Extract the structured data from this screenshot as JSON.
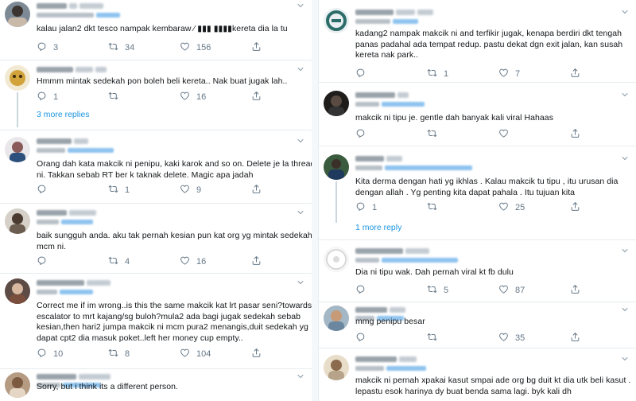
{
  "left": {
    "t1": {
      "lines": [
        "kalau jalan2 dkt tesco nampak kembaraw ⁄ ▮▮▮ ▮▮▮▮kereta dia la tu"
      ],
      "counts": {
        "reply": "3",
        "retweet": "34",
        "like": "156"
      }
    },
    "t2": {
      "lines": [
        "Hmmm mintak sedekah pon boleh beli kereta.. Nak buat jugak lah.."
      ],
      "counts": {
        "reply": "1",
        "retweet": "",
        "like": "16"
      },
      "more": "3 more replies"
    },
    "t3": {
      "lines": [
        "Orang dah kata makcik ni penipu, kaki karok and so on. Delete je la thread",
        "ni. Takkan sebab RT ber k taknak delete. Magic apa jadah"
      ],
      "counts": {
        "reply": "",
        "retweet": "1",
        "like": "9"
      }
    },
    "t4": {
      "lines": [
        "baik sungguh anda. aku tak pernah kesian pun kat org yg mintak sedekah",
        "mcm ni."
      ],
      "counts": {
        "reply": "",
        "retweet": "4",
        "like": "16"
      }
    },
    "t5": {
      "lines": [
        "Correct me if im wrong..is this the same makcik kat lrt pasar seni?towards",
        "escalator to mrt kajang/sg buloh?mula2 ada bagi jugak sedekah sebab",
        "kesian,then hari2 jumpa makcik ni mcm pura2 menangis,duit sedekah yg",
        "dapat cpt2 dia masuk poket..left her money cup empty.."
      ],
      "counts": {
        "reply": "10",
        "retweet": "8",
        "like": "104"
      }
    },
    "t6": {
      "lines": [
        "Sorry, but i think its a different person."
      ]
    }
  },
  "right": {
    "t1": {
      "lines": [
        "kadang2 nampak makcik ni and terfikir jugak, kenapa berdiri dkt tengah",
        "panas padahal ada tempat redup. pastu dekat dgn exit jalan, kan susah",
        "kereta nak park.."
      ],
      "counts": {
        "reply": "",
        "retweet": "1",
        "like": "7"
      }
    },
    "t2": {
      "lines": [
        "makcik ni tipu je. gentle dah banyak kali viral Hahaas"
      ],
      "counts": {
        "reply": "",
        "retweet": "",
        "like": ""
      }
    },
    "t3": {
      "lines": [
        "Kita derma dengan hati yg ikhlas . Kalau makcik tu tipu , itu urusan dia",
        "dengan allah . Yg penting kita dapat pahala . Itu tujuan kita"
      ],
      "counts": {
        "reply": "1",
        "retweet": "",
        "like": "25"
      },
      "more": "1 more reply"
    },
    "t4": {
      "lines": [
        "Dia ni tipu wak. Dah pernah viral kt fb dulu"
      ],
      "counts": {
        "reply": "",
        "retweet": "5",
        "like": "87"
      }
    },
    "t5": {
      "lines": [
        "mmg penipu besar"
      ],
      "counts": {
        "reply": "",
        "retweet": "",
        "like": "35"
      }
    },
    "t6": {
      "lines": [
        "makcik ni pernah xpakai kasut smpai ade org bg duit kt dia utk beli kasut .",
        "lepastu esok harinya dy buat benda sama lagi. byk kali dh"
      ]
    }
  },
  "colors": {
    "link": "#1b95e0",
    "icon": "#657786",
    "divider": "#e6ecf0",
    "text": "#14171a"
  },
  "icons": {
    "reply": "reply-icon",
    "retweet": "retweet-icon",
    "like": "like-icon",
    "share": "share-icon",
    "menu": "chevron-down-icon"
  }
}
